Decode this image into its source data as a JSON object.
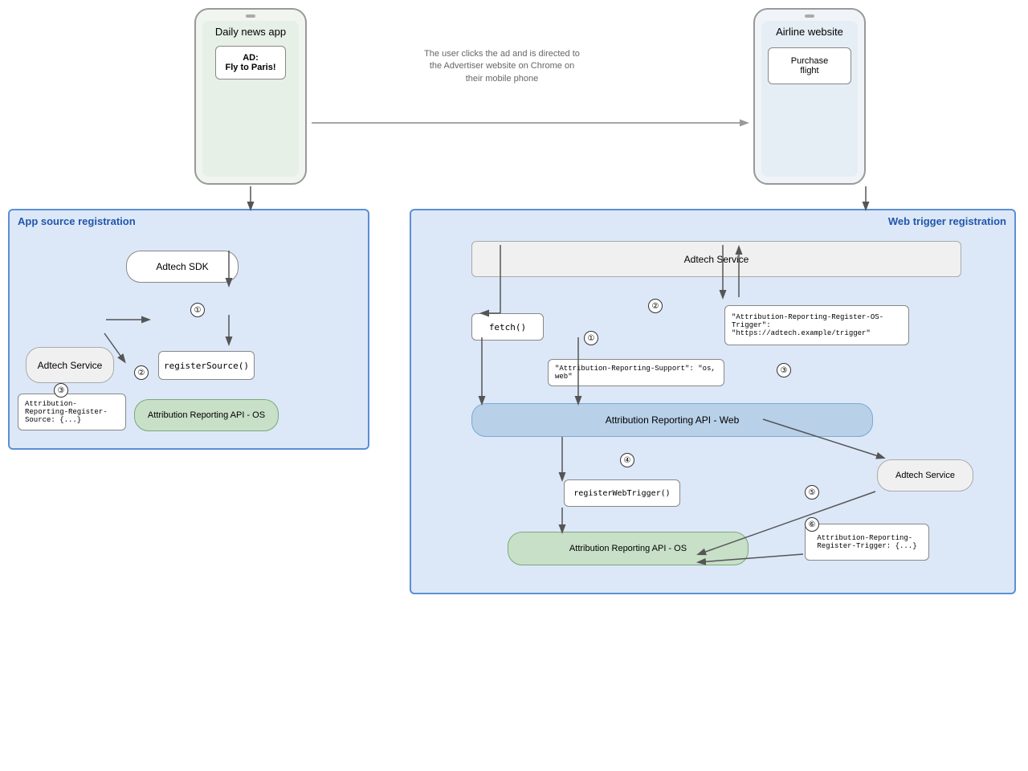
{
  "phones": {
    "left": {
      "title": "Daily news app",
      "ad_text": "AD:\nFly to Paris!"
    },
    "right": {
      "title": "Airline website",
      "purchase_text": "Purchase flight"
    }
  },
  "arrow_label": "The user clicks the ad and is directed to\nthe Advertiser website on Chrome on\ntheir mobile phone",
  "app_source": {
    "title": "App source registration",
    "adtech_sdk": "Adtech SDK",
    "adtech_service": "Adtech Service",
    "register_source": "registerSource()",
    "attribution_os": "Attribution Reporting API - OS",
    "code_box": "Attribution-Reporting-Register-\nSource: {...}"
  },
  "web_trigger": {
    "title": "Web trigger registration",
    "adtech_service_top": "Adtech Service",
    "fetch": "fetch()",
    "os_trigger_header": "\"Attribution-Reporting-Register-OS-Trigger\":\n\"https://adtech.example/trigger\"",
    "support_header": "\"Attribution-Reporting-Support\": \"os, web\"",
    "attribution_web": "Attribution Reporting API - Web",
    "register_web_trigger": "registerWebTrigger()",
    "adtech_service_right": "Adtech Service",
    "attribution_os": "Attribution Reporting API - OS",
    "code_trigger": "Attribution-Reporting-\nRegister-Trigger: {...}"
  },
  "step_numbers": {
    "app_1": "①",
    "app_2": "②",
    "app_3": "③",
    "web_1": "①",
    "web_2": "②",
    "web_3": "③",
    "web_4": "④",
    "web_5": "⑤",
    "web_6": "⑥"
  }
}
